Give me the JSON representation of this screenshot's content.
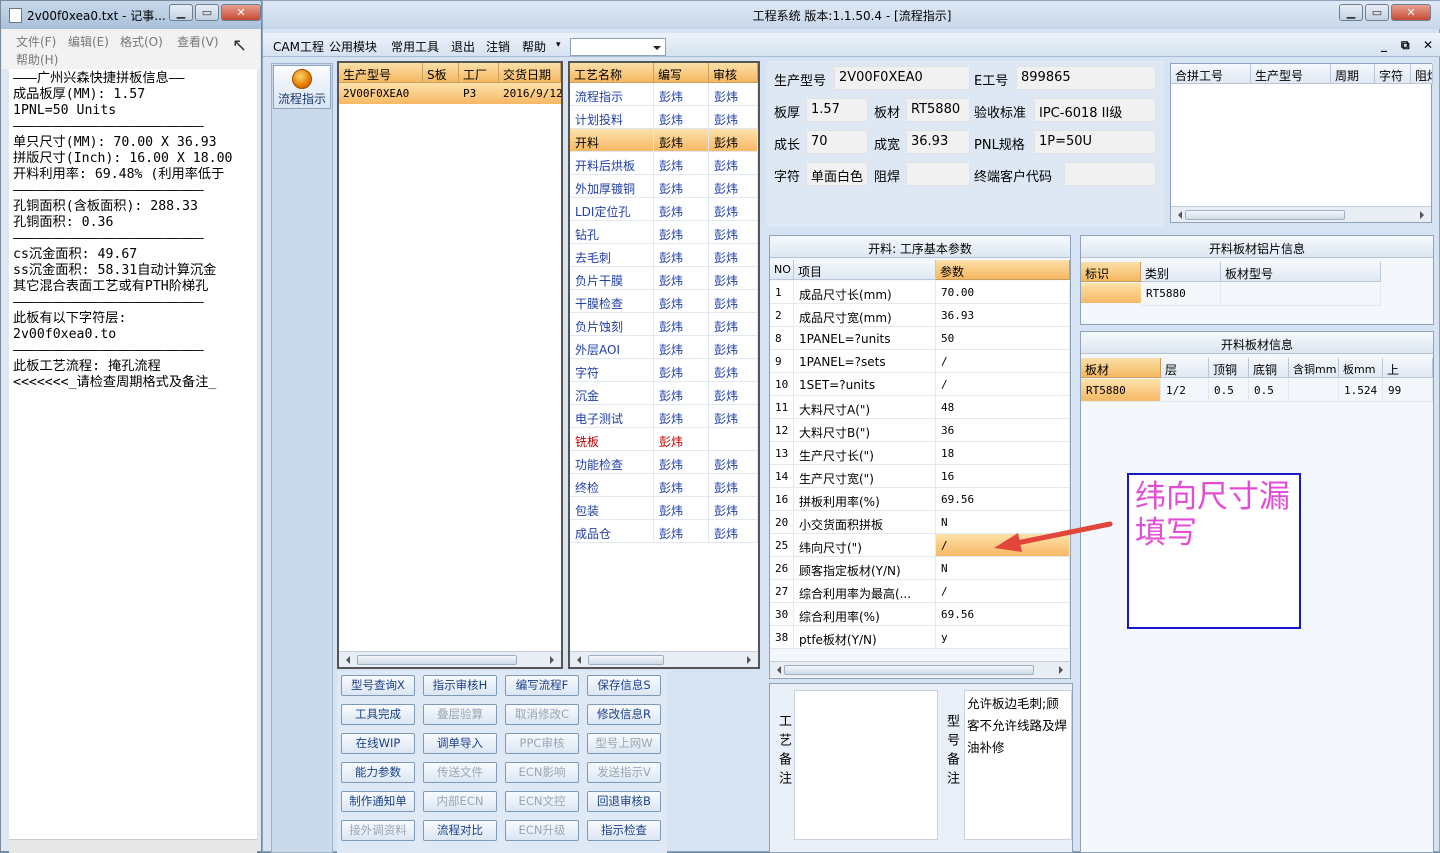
{
  "notepad": {
    "title": "2v00f0xea0.txt - 记事...",
    "menu": [
      "文件(F)",
      "编辑(E)",
      "格式(O)",
      "查看(V)",
      "帮助(H)"
    ],
    "lines": [
      "———广州兴森快捷拼板信息——",
      "成品板厚(MM): 1.57",
      "1PNL=50 Units",
      "————————————————————————",
      "单只尺寸(MM): 70.00 X 36.93",
      "拼版尺寸(Inch): 16.00 X 18.00",
      "开料利用率: 69.48% (利用率低于",
      "————————————————————————",
      "孔铜面积(含板面积): 288.33",
      "孔铜面积: 0.36",
      "————————————————————————",
      "cs沉金面积: 49.67",
      "ss沉金面积: 58.31自动计算沉金",
      "其它混合表面工艺或有PTH阶梯孔",
      "————————————————————————",
      "此板有以下字符层:",
      "2v00f0xea0.to",
      "————————————————————————",
      "此板工艺流程: 掩孔流程",
      "<<<<<<<_请检查周期格式及备注_"
    ]
  },
  "app": {
    "title": "工程系统  版本:1.1.50.4 - [流程指示]",
    "menu": [
      "CAM工程",
      "公用模块",
      "常用工具",
      "退出",
      "注销",
      "帮助"
    ],
    "side_button": "流程指示",
    "models": {
      "headers": [
        "生产型号",
        "S板",
        "工厂",
        "交货日期"
      ],
      "row": [
        "2V00F0XEA0",
        "",
        "P3",
        "2016/9/12"
      ]
    },
    "processes": {
      "headers": [
        "工艺名称",
        "编写",
        "审核"
      ],
      "rows": [
        [
          "流程指示",
          "彭炜",
          "彭炜"
        ],
        [
          "计划投料",
          "彭炜",
          "彭炜"
        ],
        [
          "开料",
          "彭炜",
          "彭炜"
        ],
        [
          "开料后烘板",
          "彭炜",
          "彭炜"
        ],
        [
          "外加厚镀铜",
          "彭炜",
          "彭炜"
        ],
        [
          "LDI定位孔",
          "彭炜",
          "彭炜"
        ],
        [
          "钻孔",
          "彭炜",
          "彭炜"
        ],
        [
          "去毛刺",
          "彭炜",
          "彭炜"
        ],
        [
          "负片干膜",
          "彭炜",
          "彭炜"
        ],
        [
          "干膜检查",
          "彭炜",
          "彭炜"
        ],
        [
          "负片蚀刻",
          "彭炜",
          "彭炜"
        ],
        [
          "外层AOI",
          "彭炜",
          "彭炜"
        ],
        [
          "字符",
          "彭炜",
          "彭炜"
        ],
        [
          "沉金",
          "彭炜",
          "彭炜"
        ],
        [
          "电子测试",
          "彭炜",
          "彭炜"
        ],
        [
          "铣板",
          "彭炜",
          ""
        ],
        [
          "功能检查",
          "彭炜",
          "彭炜"
        ],
        [
          "终检",
          "彭炜",
          "彭炜"
        ],
        [
          "包装",
          "彭炜",
          "彭炜"
        ],
        [
          "成品仓",
          "彭炜",
          "彭炜"
        ]
      ]
    },
    "buttons": [
      [
        "型号查询X",
        "指示审核H",
        "编写流程F",
        "保存信息S"
      ],
      [
        "工具完成",
        "叠层验算",
        "取消修改C",
        "修改信息R"
      ],
      [
        "在线WIP",
        "调单导入",
        "PPC审核",
        "型号上网W"
      ],
      [
        "能力参数",
        "传送文件",
        "ECN影响",
        "发送指示V"
      ],
      [
        "制作通知单",
        "内部ECN",
        "ECN文控",
        "回退审核B"
      ],
      [
        "接外调资料",
        "流程对比",
        "ECN升级",
        "指示检查"
      ]
    ],
    "info": {
      "prod_model_label": "生产型号",
      "prod_model": "2V00F0XEA0",
      "e_no_label": "E工号",
      "e_no": "899865",
      "thick_label": "板厚",
      "thick": "1.57",
      "mat_label": "板材",
      "mat": "RT5880",
      "std_label": "验收标准",
      "std": "IPC-6018 II级",
      "len_label": "成长",
      "len": "70",
      "wid_label": "成宽",
      "wid": "36.93",
      "pnl_label": "PNL规格",
      "pnl": "1P=50U",
      "char_label": "字符",
      "char": "单面白色",
      "solder_label": "阻焊",
      "solder": "",
      "cust_label": "终端客户代码",
      "cust": ""
    },
    "combine": {
      "headers": [
        "合拼工号",
        "生产型号",
        "周期",
        "字符",
        "阻焊"
      ]
    },
    "params": {
      "title": "开料: 工序基本参数",
      "headers": [
        "NO",
        "项目",
        "参数"
      ],
      "rows": [
        [
          "1",
          "成品尺寸长(mm)",
          "70.00"
        ],
        [
          "2",
          "成品尺寸宽(mm)",
          "36.93"
        ],
        [
          "8",
          "1PANEL=?units",
          "50"
        ],
        [
          "9",
          "1PANEL=?sets",
          "/"
        ],
        [
          "10",
          "1SET=?units",
          "/"
        ],
        [
          "11",
          "大料尺寸A(\")",
          "48"
        ],
        [
          "12",
          "大料尺寸B(\")",
          "36"
        ],
        [
          "13",
          "生产尺寸长(\")",
          "18"
        ],
        [
          "14",
          "生产尺寸宽(\")",
          "16"
        ],
        [
          "16",
          "拼板利用率(%)",
          "69.56"
        ],
        [
          "20",
          "小交货面积拼板",
          "N"
        ],
        [
          "25",
          "纬向尺寸(\")",
          "/"
        ],
        [
          "26",
          "顾客指定板材(Y/N)",
          "N"
        ],
        [
          "27",
          "综合利用率为最高(...",
          "/"
        ],
        [
          "30",
          "综合利用率(%)",
          "69.56"
        ],
        [
          "38",
          "ptfe板材(Y/N)",
          "y"
        ]
      ]
    },
    "plate_img": {
      "title": "开料板材铝片信息",
      "headers": [
        "标识",
        "类别",
        "板材型号"
      ],
      "row": [
        "",
        "RT5880",
        ""
      ]
    },
    "plate": {
      "title": "开料板材信息",
      "headers": [
        "板材",
        "层",
        "顶铜",
        "底铜",
        "含铜mm",
        "板mm",
        "上"
      ],
      "row": [
        "RT5880",
        "1/2",
        "0.5",
        "0.5",
        "",
        "1.524",
        "99"
      ]
    },
    "process_note_label": "工艺备注",
    "model_note_label": "型号备注",
    "model_note": "允许板边毛刺;顾客不允许线路及焊油补修",
    "annotation": "纬向尺寸漏填写",
    "colors": {
      "accent": "#f5b760",
      "note_border": "#1818c8",
      "note_text": "#e34cd6",
      "arrow": "#e2463a"
    }
  }
}
